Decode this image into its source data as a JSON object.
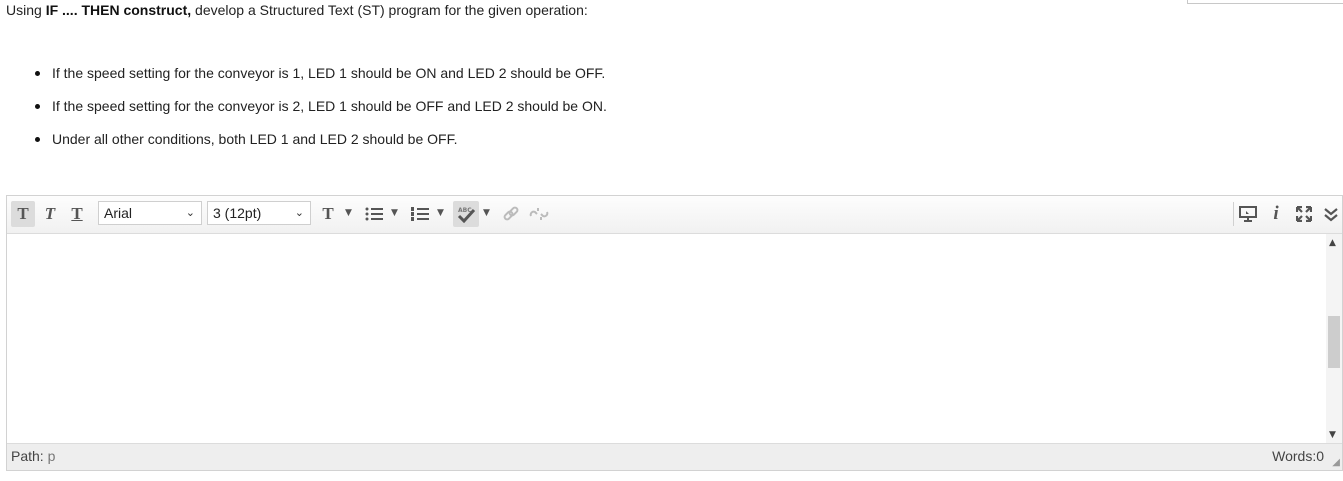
{
  "question": {
    "prefix": "Using ",
    "bold_part": "IF .... THEN construct,",
    "suffix": " develop a Structured Text (ST) program for the given operation:"
  },
  "bullets": [
    "If the speed setting  for the conveyor is 1, LED 1 should be ON and LED 2 should be OFF.",
    "If the speed setting  for the conveyor is 2, LED 1 should be OFF and LED 2 should be ON.",
    "Under all other conditions, both LED 1 and LED 2 should be OFF."
  ],
  "editor": {
    "font_select": "Arial",
    "size_select": "3 (12pt)",
    "content": "",
    "path_label": "Path:",
    "path_value": "p",
    "words_label": "Words:0"
  },
  "icons": [
    "text-bold-icon",
    "text-italic-icon",
    "text-underline-icon",
    "text-color-icon",
    "bullet-list-icon",
    "numbered-list-icon",
    "spellcheck-icon",
    "link-icon",
    "unlink-icon",
    "preview-icon",
    "info-icon",
    "fullscreen-icon",
    "collapse-toolbar-icon"
  ]
}
